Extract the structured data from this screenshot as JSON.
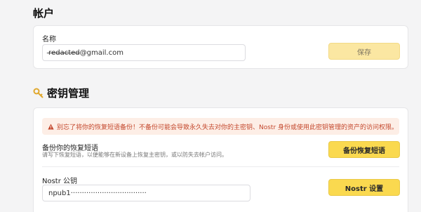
{
  "account_section": {
    "title": "帐户",
    "email_label": "名称",
    "email_value": "r̶e̶d̶a̶c̶t̶e̶d̶@gmail.com",
    "save_label": "保存"
  },
  "keys_section": {
    "icon": "key-icon",
    "title": "密钥管理",
    "warning": {
      "icon": "warning-triangle-icon",
      "text": "别忘了将你的恢复短语备份！不备份可能会导致永久失去对你的主密钥、Nostr 身份或使用此密钥管理的资产的访问权限。"
    },
    "backup": {
      "title": "备份你的恢复短语",
      "description": "请写下恢复短语，以便能够在新设备上恢复主密钥，或以防失去帐户访问。",
      "button_label": "备份恢复短语"
    },
    "nostr": {
      "label": "Nostr 公钥",
      "value": "npub1··································",
      "button_label": "Nostr 设置"
    }
  },
  "colors": {
    "accent": "#fad94f",
    "accent_disabled": "#fbe7a2",
    "warning_bg": "#fdeee6",
    "warning_text": "#c4472c",
    "key_icon": "#e0a82e"
  }
}
